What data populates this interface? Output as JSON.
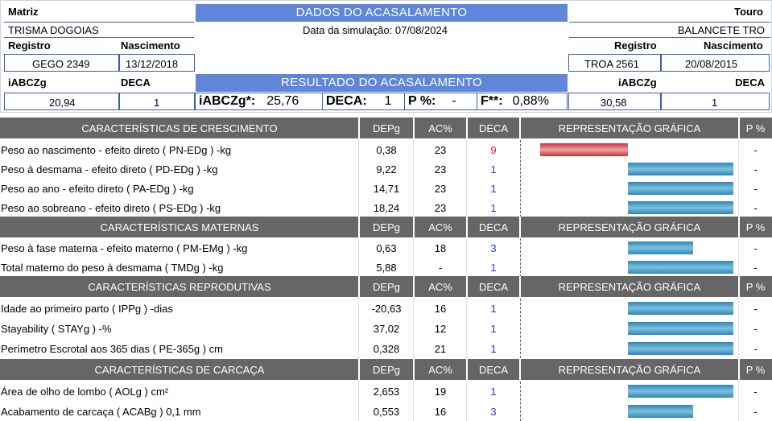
{
  "header": {
    "matriz_label": "Matriz",
    "matriz_name": "TRISMA DOGOIAS",
    "title": "DADOS DO ACASALAMENTO",
    "simulation_date": "Data da simulação: 07/08/2024",
    "touro_label": "Touro",
    "touro_name": "BALANCETE TRO",
    "registro_label": "Registro",
    "nascimento_label": "Nascimento",
    "matriz_registro": "GEGO 2349",
    "matriz_nascimento": "13/12/2018",
    "touro_registro": "TROA 2561",
    "touro_nascimento": "20/08/2015",
    "iabczg_label": "iABCZg",
    "deca_label": "DECA",
    "matriz_iabczg": "20,94",
    "matriz_deca": "1",
    "touro_iabczg": "30,58",
    "touro_deca": "1",
    "result_title": "RESULTADO DO ACASALAMENTO",
    "result": {
      "iabczg_label": "iABCZg*:",
      "iabczg_value": "25,76",
      "deca_label": "DECA:",
      "deca_value": "1",
      "p_label": "P %:",
      "p_value": "-",
      "f_label": "F**:",
      "f_value": "0,88%"
    }
  },
  "columns": {
    "depg": "DEPg",
    "ac": "AC%",
    "deca": "DECA",
    "rep": "REPRESENTAÇÃO GRÁFICA",
    "p": "P %"
  },
  "colors": {
    "header_band": "#5f86d8",
    "section_band": "#666666",
    "bar_blue": "#2e86b8",
    "bar_red": "#c9313a",
    "deca_blue": "#1f3fb8",
    "deca_red": "#c3272b"
  },
  "sections": [
    {
      "title": "CARACTERÍSTICAS DE CRESCIMENTO",
      "rows": [
        {
          "name": "Peso ao nascimento - efeito direto ( PN-EDg ) -kg",
          "depg": "0,38",
          "ac": "23",
          "deca": "9",
          "deca_color": "red",
          "bar": {
            "dir": "neg",
            "size": 0.38
          },
          "p": "-"
        },
        {
          "name": "Peso à desmama - efeito direto ( PD-EDg ) -kg",
          "depg": "9,22",
          "ac": "23",
          "deca": "1",
          "deca_color": "blue",
          "bar": {
            "dir": "pos",
            "size": 0.97
          },
          "p": "-"
        },
        {
          "name": "Peso ao ano - efeito direto ( PA-EDg ) -kg",
          "depg": "14,71",
          "ac": "23",
          "deca": "1",
          "deca_color": "blue",
          "bar": {
            "dir": "pos",
            "size": 0.97
          },
          "p": "-"
        },
        {
          "name": "Peso ao sobreano - efeito direto ( PS-EDg ) -kg",
          "depg": "18,24",
          "ac": "23",
          "deca": "1",
          "deca_color": "blue",
          "bar": {
            "dir": "pos",
            "size": 0.97
          },
          "p": "-"
        }
      ]
    },
    {
      "title": "CARACTERÍSTICAS MATERNAS",
      "rows": [
        {
          "name": "Peso à fase materna - efeito materno ( PM-EMg ) -kg",
          "depg": "0,63",
          "ac": "18",
          "deca": "3",
          "deca_color": "blue",
          "bar": {
            "dir": "pos",
            "size": 0.6
          },
          "p": "-"
        },
        {
          "name": "Total materno do peso à desmama ( TMDg ) -kg",
          "depg": "5,88",
          "ac": "-",
          "deca": "1",
          "deca_color": "blue",
          "bar": {
            "dir": "pos",
            "size": 0.97
          },
          "p": "-"
        }
      ]
    },
    {
      "title": "CARACTERÍSTICAS REPRODUTIVAS",
      "rows": [
        {
          "name": "Idade ao primeiro parto ( IPPg ) -dias",
          "depg": "-20,63",
          "ac": "16",
          "deca": "1",
          "deca_color": "blue",
          "bar": {
            "dir": "pos",
            "size": 0.97
          },
          "p": "-"
        },
        {
          "name": "Stayability ( STAYg ) -%",
          "depg": "37,02",
          "ac": "12",
          "deca": "1",
          "deca_color": "blue",
          "bar": {
            "dir": "pos",
            "size": 0.97
          },
          "p": "-"
        },
        {
          "name": "Perímetro Escrotal aos 365 dias ( PE-365g ) cm",
          "depg": "0,328",
          "ac": "21",
          "deca": "1",
          "deca_color": "blue",
          "bar": {
            "dir": "pos",
            "size": 0.97
          },
          "p": "-"
        }
      ]
    },
    {
      "title": "CARACTERÍSTICAS DE CARCAÇA",
      "rows": [
        {
          "name": "Área de olho de lombo ( AOLg ) cm²",
          "depg": "2,653",
          "ac": "19",
          "deca": "1",
          "deca_color": "blue",
          "bar": {
            "dir": "pos",
            "size": 0.97
          },
          "p": "-"
        },
        {
          "name": "Acabamento de carcaça ( ACABg ) 0,1 mm",
          "depg": "0,553",
          "ac": "16",
          "deca": "3",
          "deca_color": "blue",
          "bar": {
            "dir": "pos",
            "size": 0.6
          },
          "p": "-"
        }
      ]
    }
  ]
}
